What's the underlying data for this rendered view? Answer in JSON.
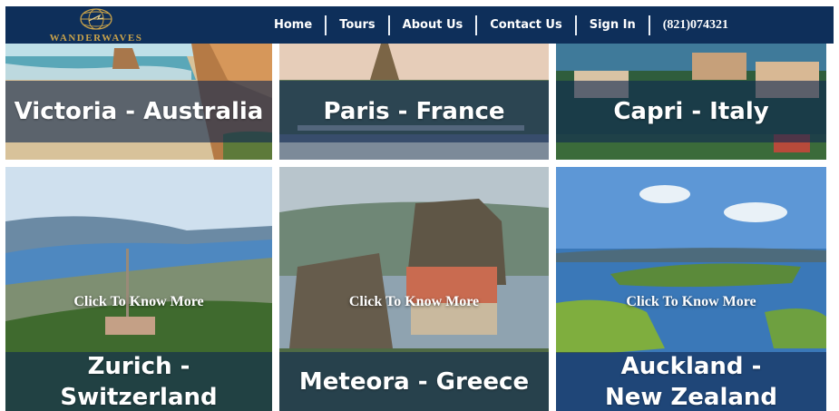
{
  "brand": {
    "name": "WANDERWAVES",
    "logo_icon": "globe-logo-icon"
  },
  "nav": {
    "links": [
      "Home",
      "Tours",
      "About Us",
      "Contact Us",
      "Sign In"
    ],
    "phone": "(821)074321"
  },
  "destinations_top": [
    {
      "title": "Victoria - Australia"
    },
    {
      "title": "Paris - France"
    },
    {
      "title": "Capri - Italy"
    }
  ],
  "destinations_bottom": [
    {
      "title": "Zurich - Switzerland",
      "cta": "Click To Know More"
    },
    {
      "title": "Meteora - Greece",
      "cta": "Click To Know More"
    },
    {
      "title": "Auckland - New Zealand",
      "cta": "Click To Know More"
    }
  ],
  "colors": {
    "navbar": "#0e2f5a",
    "brand_gold": "#c8a24a",
    "band": "#0e2850"
  }
}
